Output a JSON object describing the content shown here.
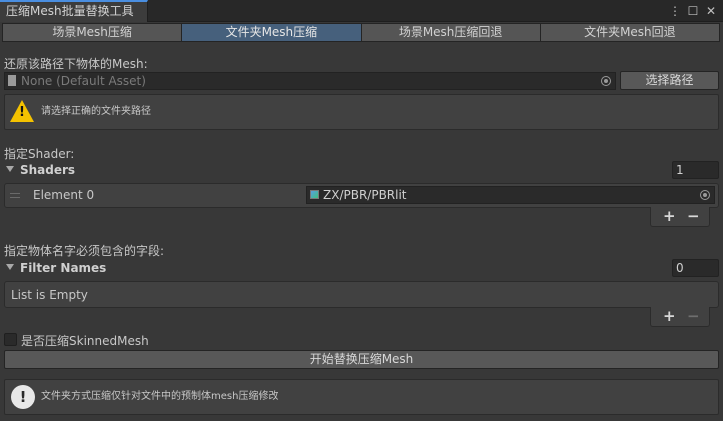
{
  "window": {
    "tab_title": "压缩Mesh批量替换工具",
    "menu_icon": "kebab-menu-icon",
    "maximize_icon": "maximize-icon",
    "close_icon": "close-icon"
  },
  "toolbar": {
    "tabs": [
      {
        "label": "场景Mesh压缩",
        "active": false
      },
      {
        "label": "文件夹Mesh压缩",
        "active": true
      },
      {
        "label": "场景Mesh压缩回退",
        "active": false
      },
      {
        "label": "文件夹Mesh回退",
        "active": false
      }
    ]
  },
  "restore": {
    "label": "还原该路径下物体的Mesh:",
    "field_value": "None (Default Asset)",
    "select_button": "选择路径"
  },
  "warning": {
    "icon": "warning-icon",
    "text": "请选择正确的文件夹路径"
  },
  "shader": {
    "label": "指定Shader:",
    "foldout": "Shaders",
    "size": "1",
    "elements": [
      {
        "label": "Element 0",
        "value": "ZX/PBR/PBRlit"
      }
    ],
    "add": "+",
    "remove": "−"
  },
  "filter": {
    "label": "指定物体名字必须包含的字段:",
    "foldout": "Filter Names",
    "size": "0",
    "empty_text": "List is Empty",
    "add": "+",
    "remove": "−"
  },
  "skinned": {
    "label": "是否压缩SkinnedMesh",
    "checked": false
  },
  "start_button": "开始替换压缩Mesh",
  "info": {
    "icon": "info-icon",
    "text": "文件夹方式压缩仅针对文件中的预制体mesh压缩修改"
  },
  "colors": {
    "background": "#383838",
    "active_tab": "#46607c",
    "warning": "#f4c200"
  }
}
